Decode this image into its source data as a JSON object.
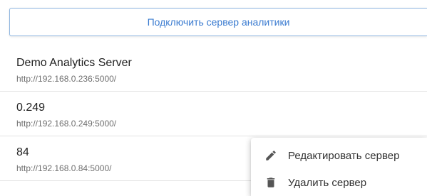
{
  "toolbar": {
    "connect_label": "Подключить сервер аналитики"
  },
  "servers": [
    {
      "name": "Demo Analytics Server",
      "url": "http://192.168.0.236:5000/"
    },
    {
      "name": "0.249",
      "url": "http://192.168.0.249:5000/"
    },
    {
      "name": "84",
      "url": "http://192.168.0.84:5000/"
    }
  ],
  "context_menu": {
    "items": [
      {
        "label": "Редактировать сервер",
        "icon": "pencil-icon"
      },
      {
        "label": "Удалить сервер",
        "icon": "trash-icon"
      }
    ]
  },
  "colors": {
    "accent": "#3a7bd0",
    "icon": "#555555"
  }
}
